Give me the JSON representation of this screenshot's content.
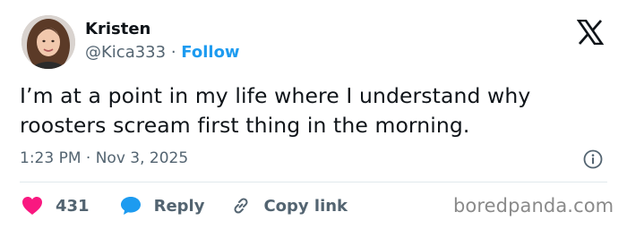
{
  "author": {
    "name": "Kristen",
    "handle": "@Kica333",
    "separator": "·",
    "follow_label": "Follow"
  },
  "tweet": {
    "line1": "I’m at a point in my life where I understand why",
    "line2": "roosters scream first thing in the morning.",
    "timestamp": "1:23 PM · Nov 3, 2025"
  },
  "actions": {
    "like_count": "431",
    "reply_label": "Reply",
    "copy_label": "Copy link"
  },
  "watermark": "boredpanda.com",
  "colors": {
    "follow": "#1d9bf0",
    "like": "#f91880",
    "reply_bubble": "#1d9bf0",
    "muted": "#536471"
  },
  "icons": [
    "x-logo-icon",
    "info-icon",
    "heart-icon",
    "speech-bubble-icon",
    "link-icon"
  ]
}
